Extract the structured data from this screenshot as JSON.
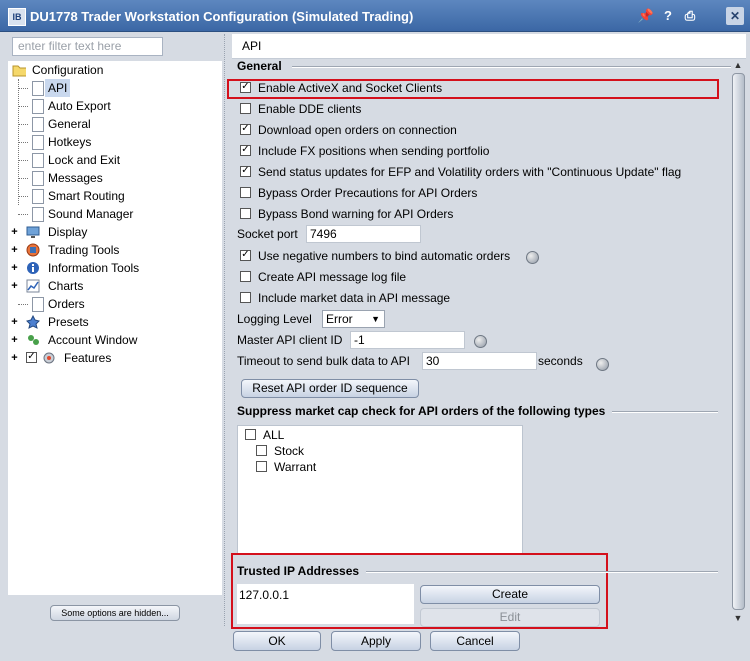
{
  "window": {
    "app_icon": "IB",
    "title": "DU1778 Trader Workstation Configuration (Simulated Trading)",
    "buttons": [
      "pin-icon",
      "help-icon",
      "print-icon",
      "close-icon"
    ]
  },
  "left": {
    "filter_placeholder": "enter filter text here",
    "tree": {
      "root": "Configuration",
      "config_children": [
        "API",
        "Auto Export",
        "General",
        "Hotkeys",
        "Lock and Exit",
        "Messages",
        "Smart Routing",
        "Sound Manager"
      ],
      "top_items": [
        "Display",
        "Trading Tools",
        "Information Tools",
        "Charts",
        "Orders",
        "Presets",
        "Account Window",
        "Features"
      ]
    },
    "hidden_button": "Some options are hidden..."
  },
  "right": {
    "header": "API",
    "general_title": "General",
    "checkboxes": [
      {
        "label": "Enable ActiveX and Socket Clients",
        "checked": true
      },
      {
        "label": "Enable DDE clients",
        "checked": false
      },
      {
        "label": "Download open orders on connection",
        "checked": true
      },
      {
        "label": "Include FX positions when sending portfolio",
        "checked": true
      },
      {
        "label": "Send status updates for EFP and Volatility orders with \"Continuous Update\" flag",
        "checked": true
      },
      {
        "label": "Bypass Order Precautions for API Orders",
        "checked": false
      },
      {
        "label": "Bypass Bond warning for API Orders",
        "checked": false
      }
    ],
    "socket_port_label": "Socket port",
    "socket_port_value": "7496",
    "checkboxes2": [
      {
        "label": "Use negative numbers to bind automatic orders",
        "checked": true
      },
      {
        "label": "Create API message log file",
        "checked": false
      },
      {
        "label": "Include market data in API message",
        "checked": false
      }
    ],
    "logging_level_label": "Logging Level",
    "logging_level_value": "Error",
    "master_client_label": "Master API client ID",
    "master_client_value": "-1",
    "timeout_label": "Timeout to send bulk data to API",
    "timeout_value": "30",
    "timeout_unit": "seconds",
    "reset_button": "Reset API order ID sequence",
    "suppress_title": "Suppress market cap check for API orders of the following types",
    "suppress_items": {
      "all": "ALL",
      "stock": "Stock",
      "warrant": "Warrant"
    },
    "trusted_title": "Trusted IP Addresses",
    "trusted_ip": "127.0.0.1",
    "create_button": "Create",
    "edit_button": "Edit"
  },
  "footer": {
    "ok": "OK",
    "apply": "Apply",
    "cancel": "Cancel"
  },
  "colors": {
    "highlight": "#d4101c",
    "titlebar": "#3b67a5"
  }
}
